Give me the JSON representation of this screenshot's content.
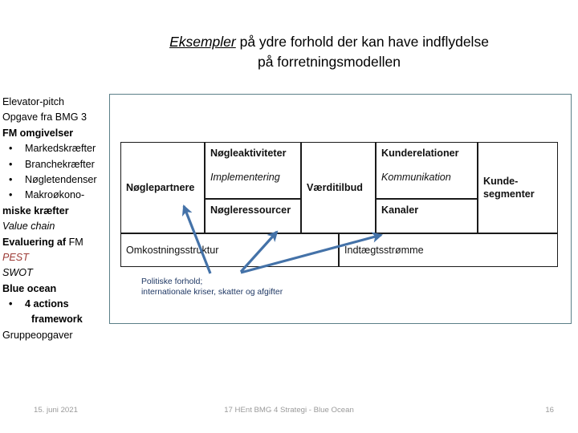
{
  "title": {
    "emphasis": "Eksempler",
    "rest": " på ydre forhold der kan have indflydelse",
    "line2": "på forretningsmodellen"
  },
  "outline": {
    "items": [
      {
        "text": "Elevator-pitch",
        "style": "normal",
        "bullet": false
      },
      {
        "text": "Opgave fra BMG 3",
        "style": "normal",
        "bullet": false
      },
      {
        "text": "FM omgivelser",
        "style": "bold",
        "bullet": false
      },
      {
        "text": "Markedskræfter",
        "style": "normal",
        "bullet": true
      },
      {
        "text": "Branchekræfter",
        "style": "normal",
        "bullet": true
      },
      {
        "text": "Nøgletendenser",
        "style": "normal",
        "bullet": true
      },
      {
        "text": "Makroøkono-",
        "style": "normal",
        "bullet": true
      },
      {
        "text": "miske kræfter",
        "style": "bold",
        "bullet": false
      },
      {
        "text": "Value chain",
        "style": "italic",
        "bullet": false
      },
      {
        "text": "Evaluering af FM",
        "style": "bold-partial",
        "bullet": false
      },
      {
        "text": "PEST",
        "style": "red-italic",
        "bullet": false
      },
      {
        "text": "SWOT",
        "style": "italic",
        "bullet": false
      },
      {
        "text": "Blue ocean",
        "style": "bold",
        "bullet": false
      },
      {
        "text": "4 actions",
        "style": "bold",
        "bullet": true
      },
      {
        "text": "framework",
        "style": "bold-indent",
        "bullet": false
      },
      {
        "text": "Gruppeopgaver",
        "style": "normal",
        "bullet": false
      }
    ],
    "evaluering_bold": "Evaluering af",
    "evaluering_rest": " FM",
    "pest_color": "#9c3a35"
  },
  "canvas": {
    "key_partners": "Nøglepartnere",
    "key_activities": "Nøgleaktiviteter",
    "key_activities_sub": "Implementering",
    "key_resources": "Nøgleressourcer",
    "value_proposition": "Værditilbud",
    "customer_relationships": "Kunderelationer",
    "customer_relationships_sub": "Kommunikation",
    "channels": "Kanaler",
    "customer_segments_line1": "Kunde-",
    "customer_segments_line2": "segmenter",
    "cost_structure": "Omkostningsstruktur",
    "revenue_streams": "Indtægtsstrømme"
  },
  "annotation": {
    "line1": "Politiske forhold;",
    "line2": "internationale kriser, skatter og afgifter",
    "arrow_color": "#4472a8"
  },
  "footer": {
    "date": "15. juni 2021",
    "center": "17 HEnt  BMG 4 Strategi - Blue Ocean",
    "page": "16"
  },
  "colors": {
    "box_border": "#5b7f88",
    "table_border": "#1a1a1a",
    "footer_text": "#9a9a9a",
    "annotation_text": "#1f3864"
  }
}
